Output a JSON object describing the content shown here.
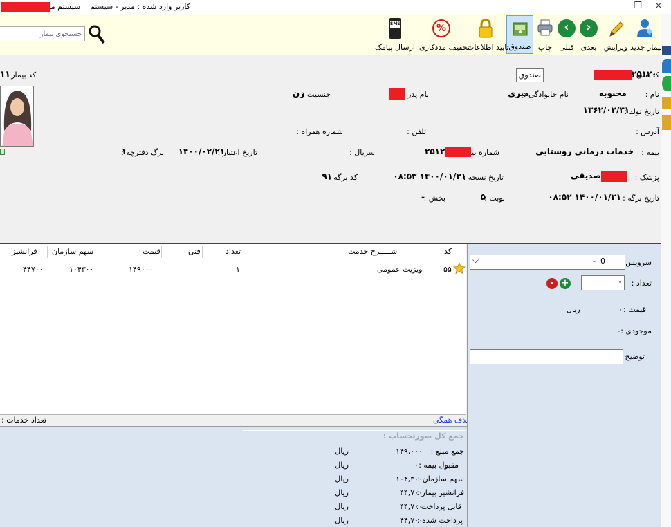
{
  "window": {
    "title_user": "کاربر وارد شده : مدیر - سیستم",
    "title_app": "سیستم مدیریت درمانگاه",
    "close_label": "×",
    "restore_label": "❐"
  },
  "toolbar": {
    "new_patient": "بیمار جدید",
    "edit": "ویرایش",
    "next": "بعدی",
    "prev": "قبلی",
    "print": "چاپ",
    "cash": "صندوق",
    "verify": "تایید اطلاعات",
    "discount": "تخفیف مددکاری",
    "sms": "ارسال پیامک",
    "sms_tag": "SMS",
    "percent_glyph": "%",
    "next_glyph": "›",
    "prev_glyph": "‹",
    "search_placeholder": "جستجوی بیمار",
    "tooltip": "صندوق"
  },
  "patient": {
    "national_code_label": "کد ملی :",
    "national_code": "۲۵۱۲۰",
    "patient_code_label": "کد بیمار :",
    "patient_code": "۱۱",
    "name_label": "نام :",
    "name": "محبوبه",
    "family_label": "نام خانوادگی :",
    "family": "میری",
    "father_label": "نام پدر :",
    "gender_label": "جنسیت :",
    "gender": "زن",
    "birth_label": "تاریخ تولد :",
    "birth": "۱۳۶۲/۰۲/۳۱",
    "address_label": "آدرس :",
    "phone_label": "تلفن :",
    "mobile_label": "شماره همراه :",
    "insurance_label": "بیمه :",
    "insurance": "خدمات درمانی روستایی",
    "insurance_no_label": "شماره بیمه :",
    "insurance_no": "۲۵۱۲",
    "serial_label": "سریال :",
    "expiry_label": "تاریخ اعتبار :",
    "expiry": "۱۴۰۰/۰۲/۲۱",
    "booklet_page_label": "برگ دفترچه :",
    "booklet_page": "۱",
    "doctor_label": "پزشک :",
    "doctor": "صدیقی",
    "prescription_date_label": "تاریخ نسخه :",
    "prescription_date": "۱۴۰۰/۰۱/۳۱ ۰۸:۵۳",
    "sheet_code_label": "کد برگه :",
    "sheet_code": "۹۱",
    "sheet_date_label": "تاریخ برگه :",
    "sheet_date": "۱۴۰۰/۰۱/۳۱ ۰۸:۵۲",
    "turn_label": "نوبت :",
    "turn": "۵",
    "ward_label": "بخش :",
    "ward": "-"
  },
  "grid": {
    "headers": {
      "code": "کد",
      "desc": "شـــــرح خدمت",
      "count": "تعداد",
      "tech": "فنی",
      "price": "قیمت",
      "org_share": "سهم سازمان",
      "franchise": "فرانشیز"
    },
    "rows": [
      {
        "code": "۵۵",
        "desc": "ویزیت عمومی",
        "count": "۱",
        "tech": "",
        "price": "۱۴۹۰۰۰",
        "org_share": "۱۰۴۳۰۰",
        "franchise": "۴۴۷۰۰"
      }
    ],
    "delete_all": "حذف همگی",
    "services_count_label": "تعداد خدمات :"
  },
  "service_panel": {
    "service_label": "سرویس :",
    "service_code": "0",
    "service_dash": "-",
    "count_label": "تعداد :",
    "count_value": "۰",
    "price_label": "قیمت :",
    "price_value": "۰",
    "price_unit": "ریال",
    "stock_label": "موجودی :",
    "stock_value": "۰",
    "desc_label": "توضیح :",
    "plus": "+",
    "minus": "-",
    "dropdown_glyph": "⌵"
  },
  "summary": {
    "title": "جمع کل صورتحساب :",
    "rows": [
      {
        "label": "جمع مبلغ :",
        "value": "۱۴۹,۰۰۰",
        "unit": "ریال"
      },
      {
        "label": "مقبول بیمه :",
        "value": "۰",
        "unit": "ریال"
      },
      {
        "label": "سهم سازمان :",
        "value": "۱۰۴,۳۰۰",
        "unit": "ریال"
      },
      {
        "label": "فرانشیز بیمار :",
        "value": "۴۴,۷۰۰",
        "unit": "ریال"
      },
      {
        "label": "قابل پرداخت :",
        "value": "۴۴,۷۰۰",
        "unit": "ریال"
      },
      {
        "label": "پرداخت شده :",
        "value": "۴۴,۷۰۰",
        "unit": "ریال"
      }
    ]
  },
  "colors": {
    "toolbar_bg": "#ffffe6",
    "panel_bg": "#dbe5f1",
    "redact": "#ee1c24",
    "nav_green": "#1e8a3c"
  }
}
